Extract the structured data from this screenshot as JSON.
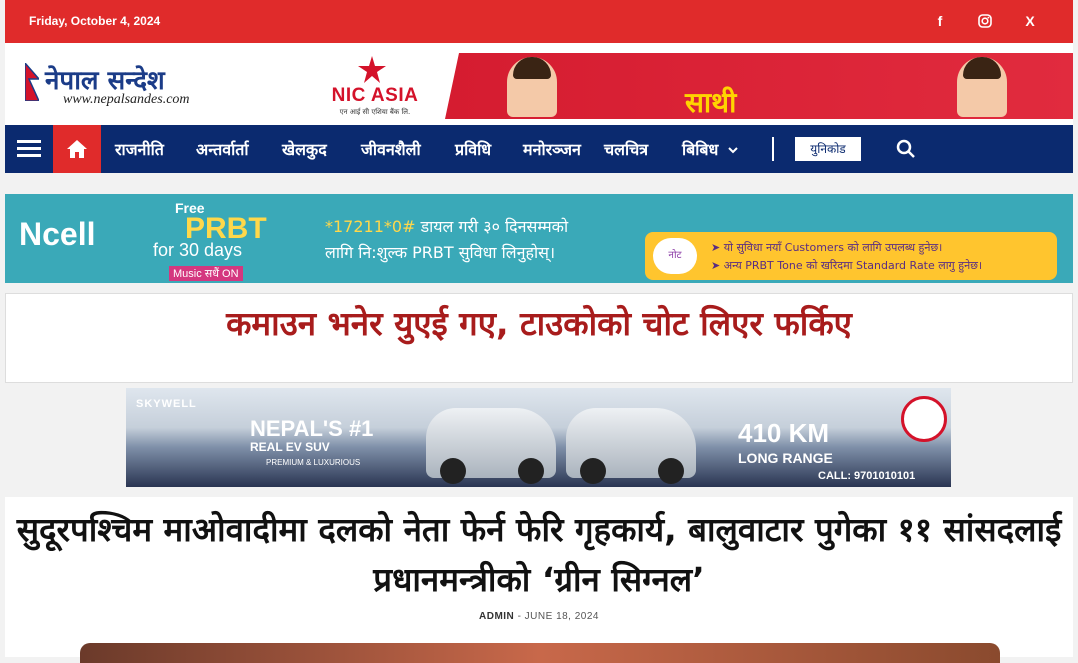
{
  "topbar": {
    "date": "Friday, October 4, 2024",
    "social": [
      {
        "name": "facebook-icon",
        "glyph": "f"
      },
      {
        "name": "instagram-icon",
        "glyph": ""
      },
      {
        "name": "x-icon",
        "glyph": "X"
      }
    ],
    "color": "#e02b2b"
  },
  "logo": {
    "name": "नेपाल सन्देश",
    "url": "www.nepalsandes.com"
  },
  "ad_top": {
    "brand": "NIC ASIA",
    "tagline": "एन आई सी एशिया बैंक लि.",
    "product": "साथी"
  },
  "nav": {
    "items": [
      "राजनीति",
      "अन्तर्वार्ता",
      "खेलकुद",
      "जीवनशैली",
      "प्रविधि",
      "मनोरञ्जन",
      "चलचित्र",
      "बिबिध"
    ],
    "unicode_label": "युनिकोड",
    "color": "#0b2a6f"
  },
  "ad_ncell": {
    "brand": "Ncell",
    "free": "Free",
    "prbt": "PRBT",
    "days": "for 30 days",
    "music": "Music सधैं ON",
    "line1_code": "*17211*0#",
    "line1_rest": " डायल गरी ३० दिनसम्मको",
    "line2": "लागि नि:शुल्क PRBT सुविधा लिनुहोस्।",
    "note_label": "नोट",
    "note1": "➤ यो सुविधा नयाँ Customers को लागि उपलब्ध हुनेछ।",
    "note2": "➤ अन्य PRBT Tone को खरिदमा Standard Rate लागु हुनेछ।"
  },
  "headline1": "कमाउन भनेर युएई गए, टाउकोको चोट लिएर फर्किए",
  "ad_skywell": {
    "brand": "SKYWELL",
    "line1": "NEPAL'S #1",
    "line2": "REAL EV SUV",
    "line3": "PREMIUM & LUXURIOUS",
    "range": "410 KM",
    "range_label": "LONG RANGE",
    "call": "CALL: 9701010101"
  },
  "article": {
    "title": "सुदूरपश्चिम माओवादीमा दलको नेता फेर्न फेरि गृहकार्य, बालुवाटार पुगेका ११ सांसदलाई प्रधानमन्त्रीको ‘ग्रीन सिग्नल’",
    "author": "ADMIN",
    "date": "JUNE 18, 2024"
  }
}
